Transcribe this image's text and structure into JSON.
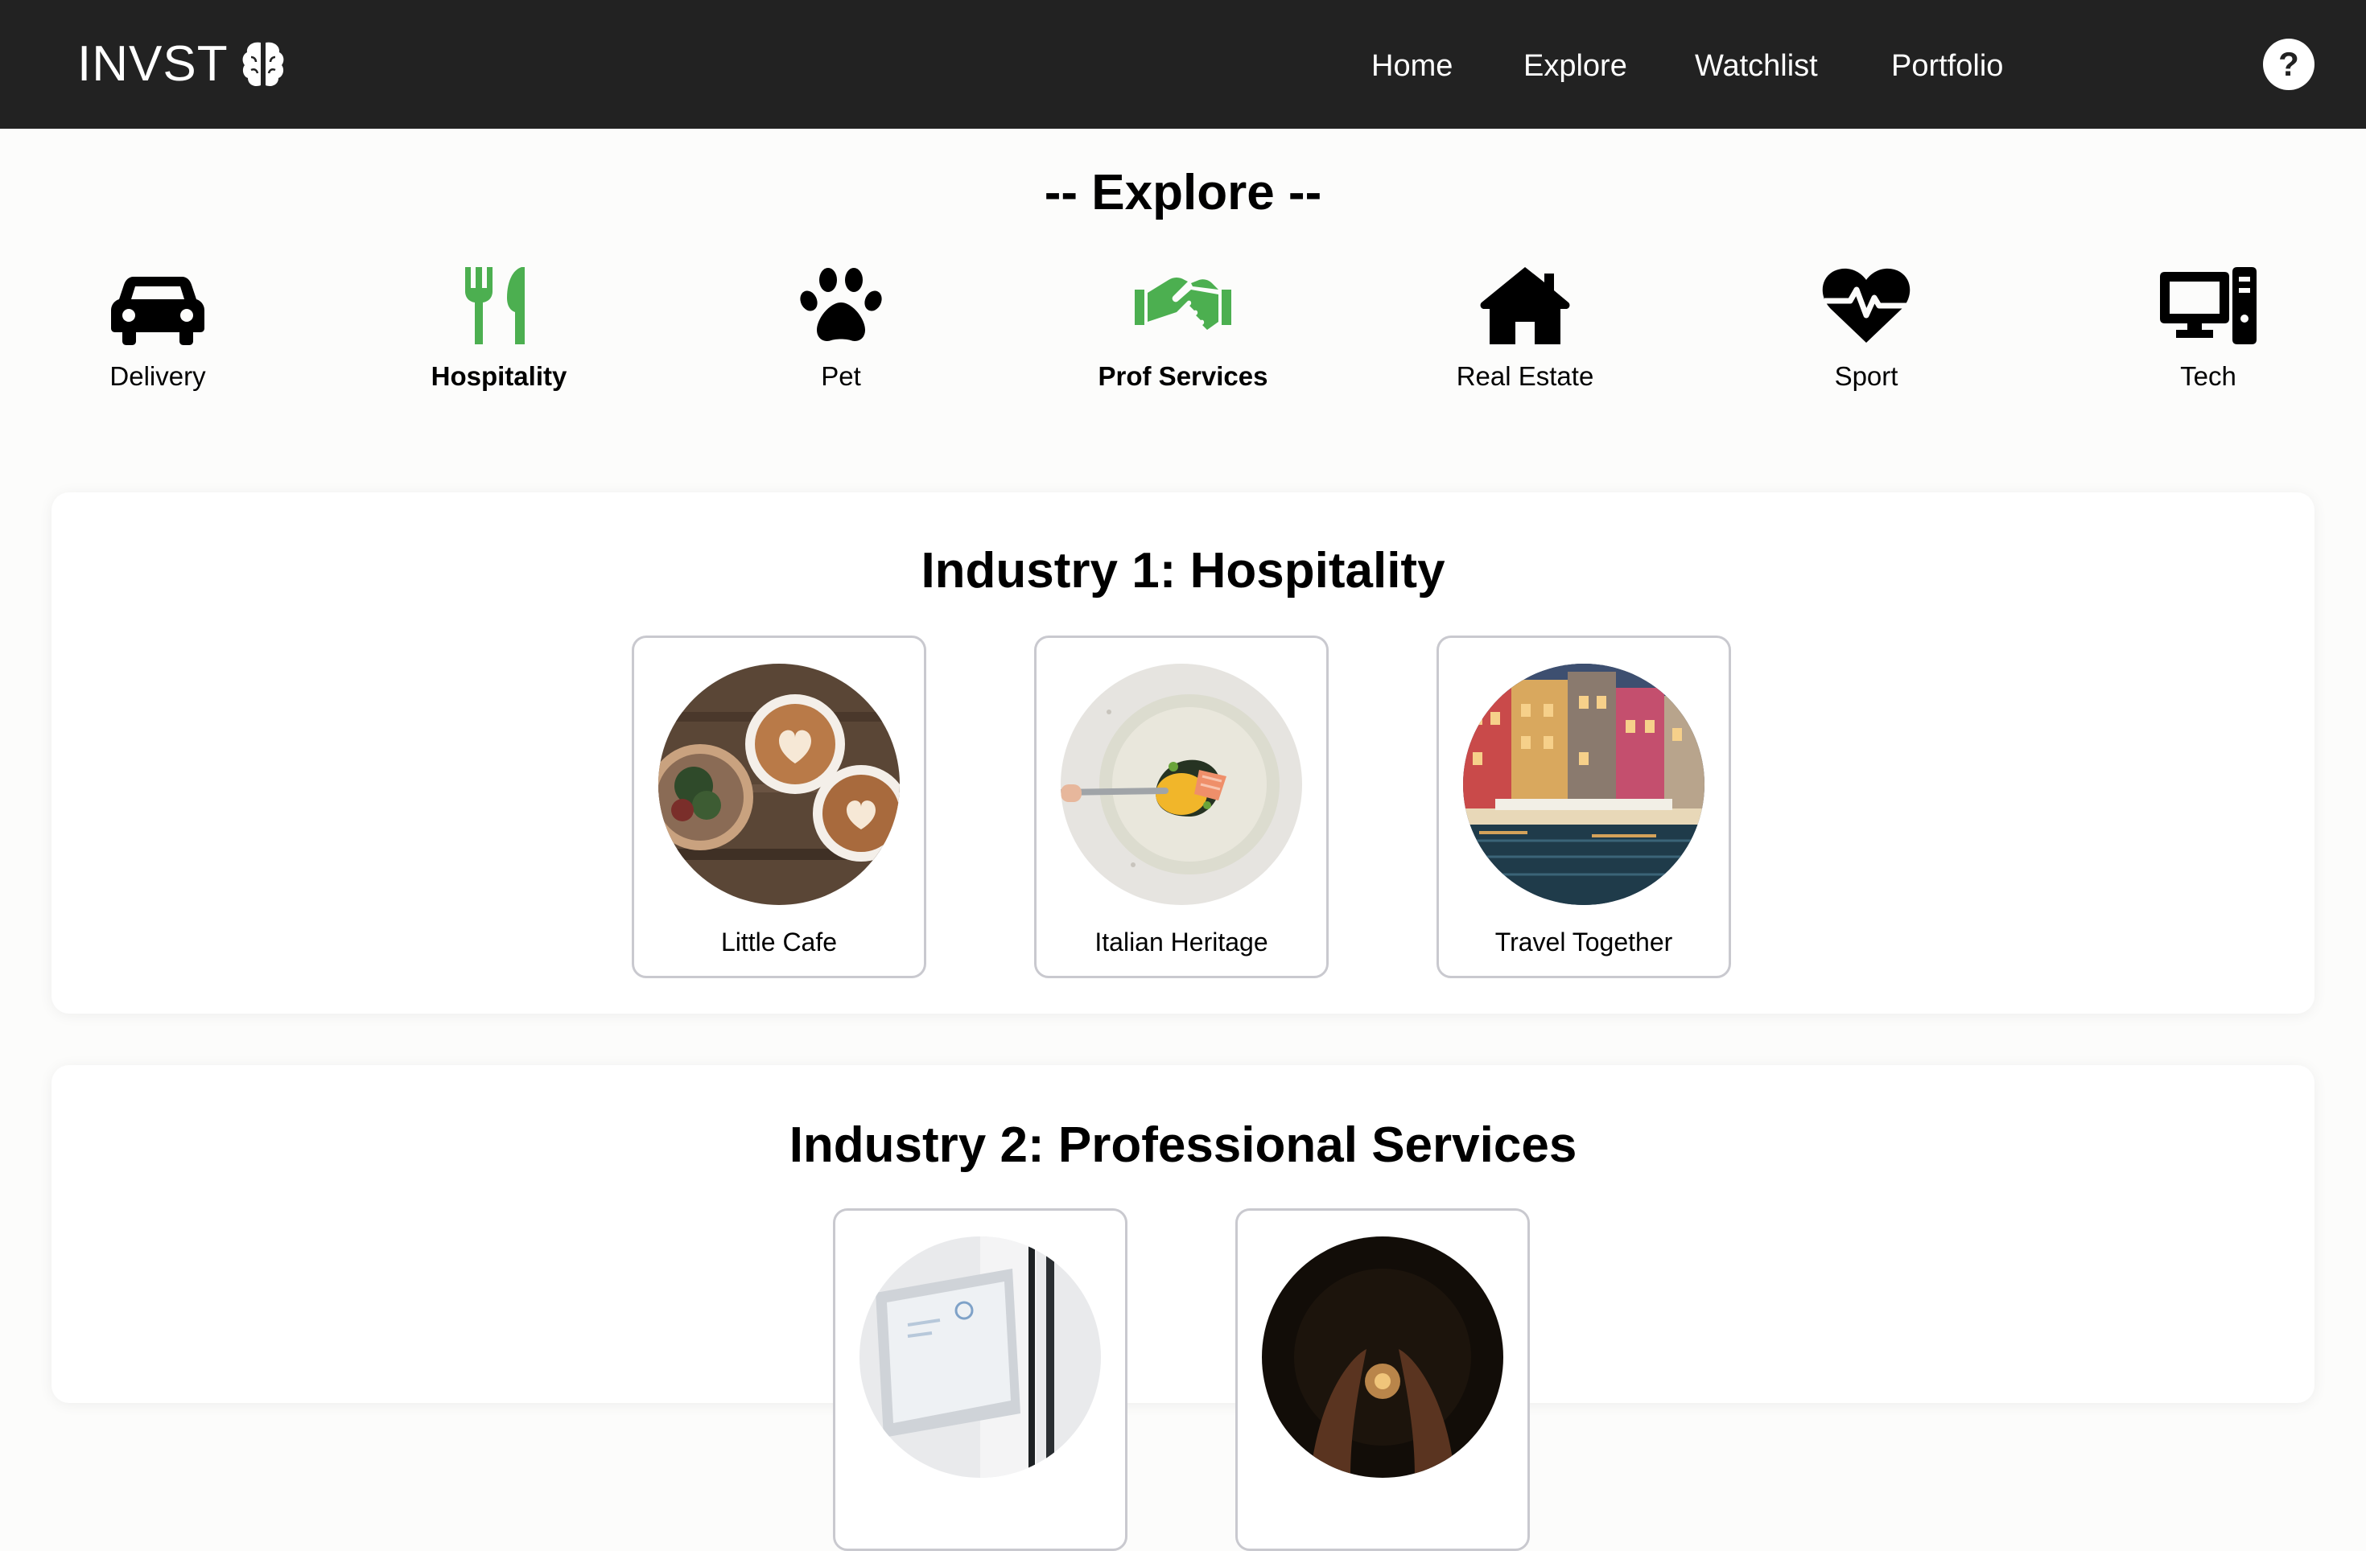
{
  "header": {
    "brand": "INVST",
    "nav": [
      "Home",
      "Explore",
      "Watchlist",
      "Portfolio"
    ],
    "help": "?"
  },
  "explore": {
    "title": "-- Explore --",
    "categories": [
      {
        "label": "Delivery",
        "icon": "car-icon",
        "active": false
      },
      {
        "label": "Hospitality",
        "icon": "utensils-icon",
        "active": true
      },
      {
        "label": "Pet",
        "icon": "paw-icon",
        "active": false
      },
      {
        "label": "Prof Services",
        "icon": "handshake-icon",
        "active": true
      },
      {
        "label": "Real Estate",
        "icon": "house-icon",
        "active": false
      },
      {
        "label": "Sport",
        "icon": "heart-pulse-icon",
        "active": false
      },
      {
        "label": "Tech",
        "icon": "computer-icon",
        "active": false
      }
    ],
    "accent": "#4caf50"
  },
  "industries": [
    {
      "title": "Industry 1: Hospitality",
      "cards": [
        {
          "label": "Little Cafe"
        },
        {
          "label": "Italian Heritage"
        },
        {
          "label": "Travel Together"
        }
      ]
    },
    {
      "title": "Industry 2: Professional Services",
      "cards": [
        {
          "label": ""
        },
        {
          "label": ""
        }
      ]
    }
  ]
}
